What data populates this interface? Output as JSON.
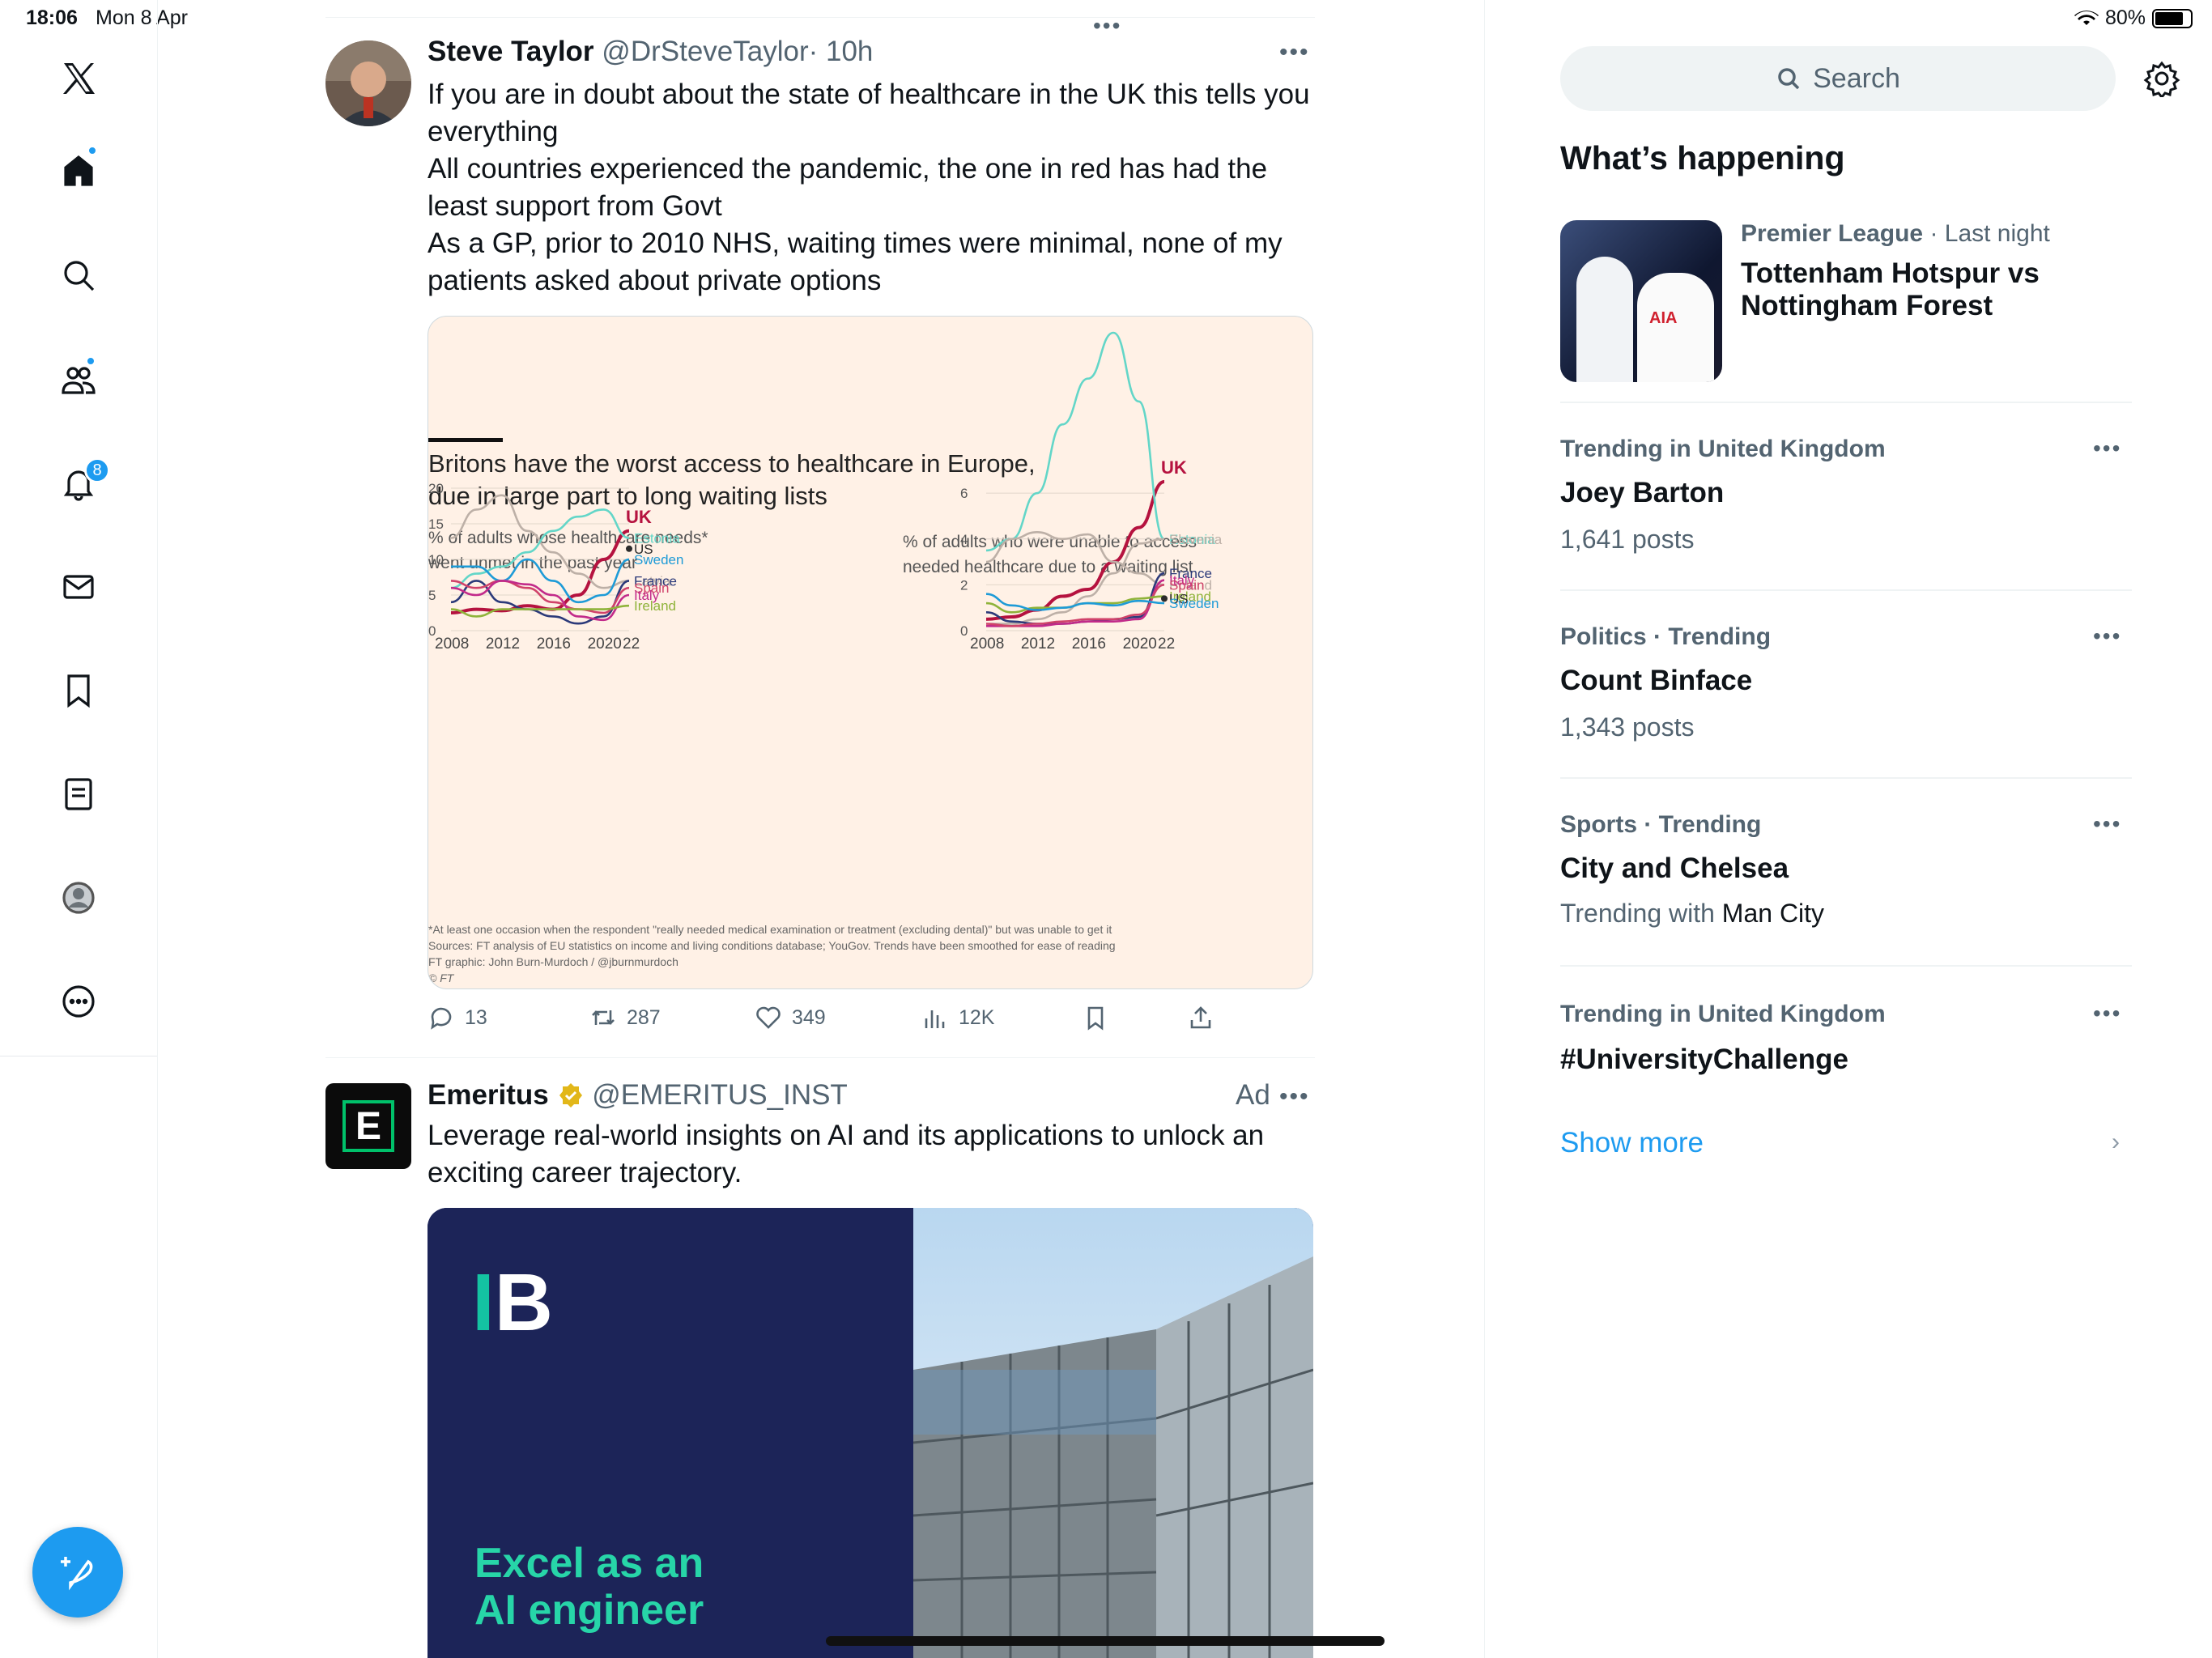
{
  "status_bar": {
    "time": "18:06",
    "date": "Mon 8 Apr",
    "battery": "80%",
    "battery_level": 0.8
  },
  "sidebar": {
    "notifications_count": "8"
  },
  "tweet": {
    "author_name": "Steve Taylor",
    "handle": "@DrSteveTaylor",
    "time": "· 10h",
    "lines": [
      "If you are in doubt about the state of healthcare in the UK this tells you",
      "everything",
      "All countries experienced the pandemic, the one in red has had the",
      "least support from Govt",
      "As a GP, prior to 2010 NHS, waiting times were minimal, none of my",
      "patients asked about private options"
    ],
    "stats": {
      "replies": "13",
      "reposts": "287",
      "likes": "349",
      "views": "12K"
    }
  },
  "chart": {
    "title_l1": "Britons have the worst access to healthcare in Europe,",
    "title_l2": "due in large part to long waiting lists",
    "left_sub_1": "% of adults whose healthcare needs*",
    "left_sub_2": "went unmet in the past year",
    "right_sub_1": "% of adults who were unable to access",
    "right_sub_2": "needed healthcare due to a waiting list",
    "footnote_1": "*At least one occasion when the respondent \"really needed medical examination or treatment (excluding dental)\" but was unable to get it",
    "footnote_2": "Sources: FT analysis of EU statistics on income and living conditions database; YouGov. Trends have been smoothed for ease of reading",
    "footnote_3": "FT graphic: John Burn-Murdoch / @jburnmurdoch",
    "footnote_4": "© FT"
  },
  "chart_data": [
    {
      "type": "line",
      "x": [
        2008,
        2010,
        2012,
        2014,
        2016,
        2018,
        2020,
        2022
      ],
      "xticks": [
        "2008",
        "2012",
        "2016",
        "2020",
        "22"
      ],
      "yticks": [
        "0",
        "5",
        "10",
        "15",
        "20"
      ],
      "ylim": [
        0,
        20
      ],
      "series": [
        {
          "name": "UK",
          "color": "#b5123f",
          "values": [
            2.5,
            3,
            2.8,
            3.5,
            3,
            5,
            10,
            14
          ]
        },
        {
          "name": "Latvia",
          "color": "#bdb0a7",
          "values": [
            13,
            17,
            19,
            14,
            11,
            8,
            6,
            7
          ]
        },
        {
          "name": "Estonia",
          "color": "#63d6c8",
          "values": [
            6,
            8,
            9,
            11,
            14,
            16,
            17,
            13
          ]
        },
        {
          "name": "US",
          "color": "#2b2b2b",
          "values": [
            null,
            null,
            null,
            null,
            null,
            null,
            null,
            11.5
          ]
        },
        {
          "name": "Sweden",
          "color": "#1e9bd7",
          "values": [
            9,
            9,
            7,
            10,
            7,
            4,
            5,
            10
          ]
        },
        {
          "name": "France",
          "color": "#2c3a7a",
          "values": [
            4,
            7,
            4,
            3,
            2,
            1,
            2,
            7
          ]
        },
        {
          "name": "Spain",
          "color": "#d0426a",
          "values": [
            7,
            6,
            7,
            6,
            4,
            3,
            2.5,
            6
          ]
        },
        {
          "name": "Italy",
          "color": "#c22a8a",
          "values": [
            6,
            5,
            7,
            6.5,
            5,
            2,
            1.5,
            5
          ]
        },
        {
          "name": "Ireland",
          "color": "#8fb33a",
          "values": [
            3,
            2,
            3,
            3,
            3,
            3,
            3,
            3.5
          ]
        }
      ],
      "labels": [
        "Latvia",
        "Estonia",
        "UK",
        "US",
        "Sweden",
        "France",
        "Spain",
        "Italy",
        "Ireland"
      ]
    },
    {
      "type": "line",
      "x": [
        2008,
        2010,
        2012,
        2014,
        2016,
        2018,
        2020,
        2022
      ],
      "xticks": [
        "2008",
        "2012",
        "2016",
        "2020",
        "22"
      ],
      "yticks": [
        "0",
        "2",
        "4",
        "6"
      ],
      "ylim": [
        0,
        6.5
      ],
      "series": [
        {
          "name": "UK",
          "color": "#b5123f",
          "values": [
            0.5,
            0.6,
            0.9,
            1.5,
            1.8,
            3,
            4.5,
            6.5
          ]
        },
        {
          "name": "Estonia",
          "color": "#63d6c8",
          "values": [
            3.5,
            4,
            6,
            9,
            11,
            13,
            10,
            4
          ]
        },
        {
          "name": "Poland",
          "color": "#bdb0a7",
          "values": [
            3,
            4,
            4.3,
            4,
            4.2,
            3,
            2.5,
            2
          ]
        },
        {
          "name": "Slovenia",
          "color": "#bdb0a7",
          "values": [
            0.3,
            0.3,
            0.5,
            0.8,
            1.5,
            2.5,
            3.8,
            4
          ]
        },
        {
          "name": "France",
          "color": "#2c3a7a",
          "values": [
            0.8,
            0.4,
            0.3,
            0.3,
            0.4,
            0.5,
            0.6,
            2.5
          ]
        },
        {
          "name": "Italy",
          "color": "#c22a8a",
          "values": [
            0.2,
            0.2,
            0.2,
            0.3,
            0.4,
            0.4,
            0.5,
            2.2
          ]
        },
        {
          "name": "Spain",
          "color": "#d0426a",
          "values": [
            0.3,
            0.2,
            0.3,
            0.4,
            0.5,
            0.5,
            0.7,
            2
          ]
        },
        {
          "name": "Ireland",
          "color": "#8fb33a",
          "values": [
            1.2,
            0.8,
            1,
            1,
            1.2,
            1.2,
            1.4,
            1.5
          ]
        },
        {
          "name": "US",
          "color": "#2b2b2b",
          "values": [
            null,
            null,
            null,
            null,
            null,
            null,
            null,
            1.4
          ]
        },
        {
          "name": "Sweden",
          "color": "#1e9bd7",
          "values": [
            1.6,
            1.1,
            0.9,
            1,
            1.2,
            1.1,
            1.3,
            1.2
          ]
        }
      ],
      "labels": [
        "Estonia",
        "Poland",
        "Slovenia",
        "UK",
        "France",
        "Italy",
        "Spain",
        "US",
        "Ireland",
        "Sweden"
      ]
    }
  ],
  "ad": {
    "name": "Emeritus",
    "handle": "@EMERITUS_INST",
    "ad_label": "Ad",
    "line1": "Leverage real-world insights on AI and its applications to unlock an",
    "line2": "exciting career trajectory.",
    "image_headline_1": "Excel as an",
    "image_headline_2": "AI engineer"
  },
  "right": {
    "search_placeholder": "Search",
    "heading": "What’s happening",
    "featured": {
      "category": "Premier League",
      "when": " · Last night",
      "title_1": "Tottenham Hotspur vs",
      "title_2": "Nottingham Forest"
    },
    "trends": [
      {
        "context": "Trending in United Kingdom",
        "title": "Joey Barton",
        "note": "1,641 posts"
      },
      {
        "context": "Politics · Trending",
        "title": "Count Binface",
        "note": "1,343 posts"
      },
      {
        "context": "Sports · Trending",
        "title": "City and Chelsea",
        "note_prefix": "Trending with ",
        "note_link": "Man City"
      },
      {
        "context": "Trending in United Kingdom",
        "title": "#UniversityChallenge"
      }
    ],
    "show_more": "Show more"
  }
}
